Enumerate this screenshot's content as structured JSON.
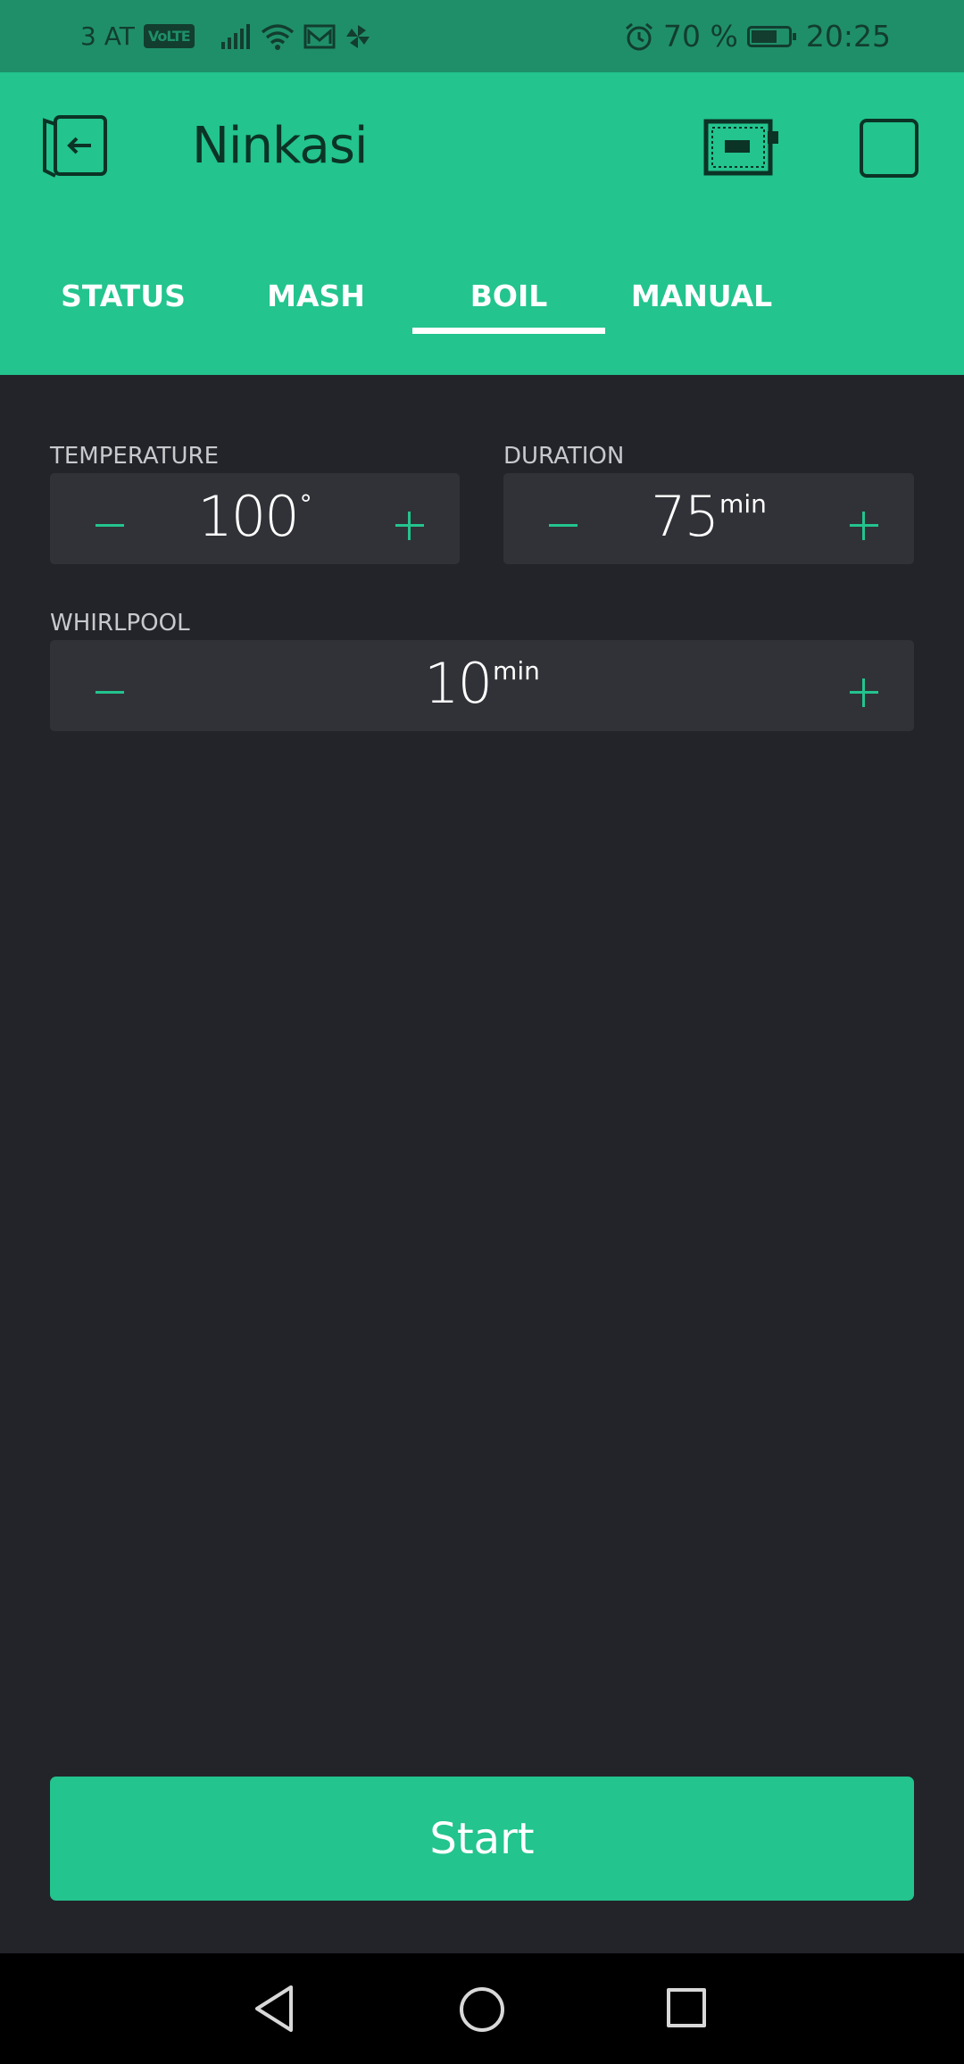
{
  "status_bar": {
    "carrier": "3 AT",
    "volte": "VoLTE",
    "battery_percent": "70 %",
    "battery_level": 0.7,
    "time": "20:25",
    "icons": [
      "signal-icon",
      "wifi-icon",
      "mail-icon",
      "pinwheel-icon",
      "alarm-icon",
      "battery-icon"
    ]
  },
  "app": {
    "title": "Ninkasi",
    "accent_color": "#23c48e",
    "background_color": "#23242a"
  },
  "tabs": [
    {
      "label": "STATUS",
      "selected": false
    },
    {
      "label": "MASH",
      "selected": false
    },
    {
      "label": "BOIL",
      "selected": true
    },
    {
      "label": "MANUAL",
      "selected": false
    }
  ],
  "controls": {
    "temperature": {
      "label": "TEMPERATURE",
      "value": "100",
      "unit": "°"
    },
    "duration": {
      "label": "DURATION",
      "value": "75",
      "unit": "min"
    },
    "whirlpool": {
      "label": "WHIRLPOOL",
      "value": "10",
      "unit": "min"
    }
  },
  "start_button": {
    "label": "Start"
  }
}
